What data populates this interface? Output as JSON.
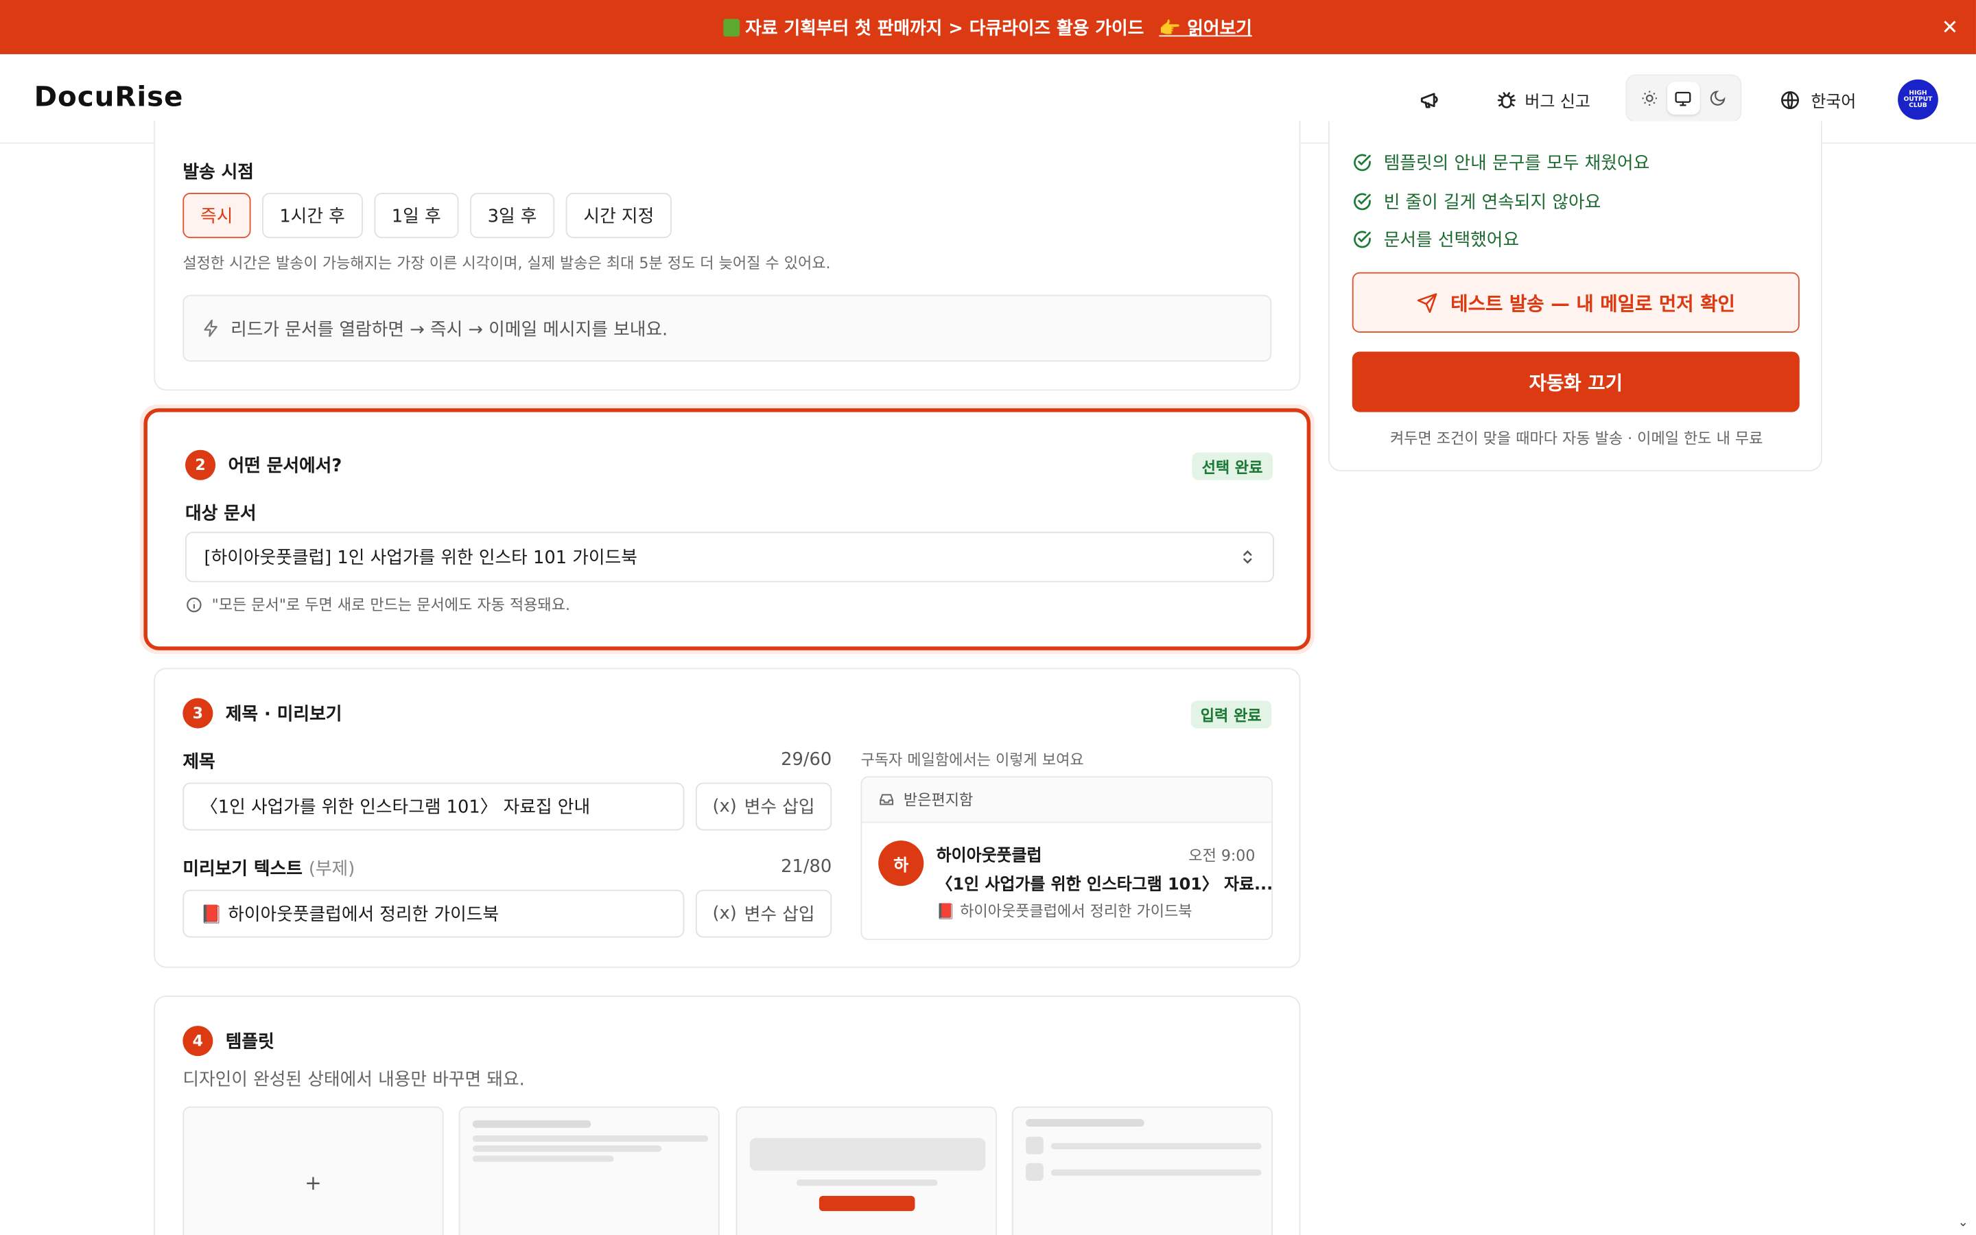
{
  "banner": {
    "text": "자료 기획부터 첫 판매까지 > 다큐라이즈 활용 가이드",
    "link": "👉 읽어보기",
    "close": "✕"
  },
  "header": {
    "logo": "DocuRise",
    "bug_report": "버그 신고",
    "language": "한국어",
    "avatar_text": "HIGH OUTPUT CLUB"
  },
  "section1": {
    "label": "발송 시점",
    "options": [
      "즉시",
      "1시간 후",
      "1일 후",
      "3일 후",
      "시간 지정"
    ],
    "selected": "즉시",
    "note": "설정한 시간은 발송이 가능해지는 가장 이른 시각이며, 실제 발송은 최대 5분 정도 더 늦어질 수 있어요.",
    "flow": "리드가 문서를 열람하면 → 즉시 → 이메일 메시지를 보내요."
  },
  "section2": {
    "number": "2",
    "title": "어떤 문서에서?",
    "badge": "선택 완료",
    "label": "대상 문서",
    "selected_doc": "[하이아웃풋클럽] 1인 사업가를 위한 인스타 101 가이드북",
    "hint": "\"모든 문서\"로 두면 새로 만드는 문서에도 자동 적용돼요."
  },
  "section3": {
    "number": "3",
    "title": "제목 · 미리보기",
    "badge": "입력 완료",
    "subject_label": "제목",
    "subject_count": "29/60",
    "subject_value": "〈1인 사업가를 위한 인스타그램 101〉 자료집 안내",
    "insert_var": "변수 삽입",
    "preview_label": "미리보기 텍스트",
    "preview_sub": "(부제)",
    "preview_count": "21/80",
    "preview_value": "📕 하이아웃풋클럽에서 정리한 가이드북",
    "inbox_caption": "구독자 메일함에서는 이렇게 보여요",
    "inbox_title": "받은편지함",
    "mail": {
      "avatar": "하",
      "sender": "하이아웃풋클럽",
      "time": "오전 9:00",
      "subject": "〈1인 사업가를 위한 인스타그램 101〉 자료...",
      "preview": "📕 하이아웃풋클럽에서 정리한 가이드북"
    }
  },
  "section4": {
    "number": "4",
    "title": "템플릿",
    "desc": "디자인이 완성된 상태에서 내용만 바꾸면 돼요.",
    "add": "+"
  },
  "right_panel": {
    "checks": [
      "템플릿의 안내 문구를 모두 채웠어요",
      "빈 줄이 길게 연속되지 않아요",
      "문서를 선택했어요"
    ],
    "test_send": "테스트 발송 — 내 메일로 먼저 확인",
    "turn_off": "자동화 끄기",
    "note": "켜두면 조건이 맞을 때마다 자동 발송 · 이메일 한도 내 무료"
  },
  "colors": {
    "accent": "#dc3a12",
    "success": "#1d7a36"
  }
}
